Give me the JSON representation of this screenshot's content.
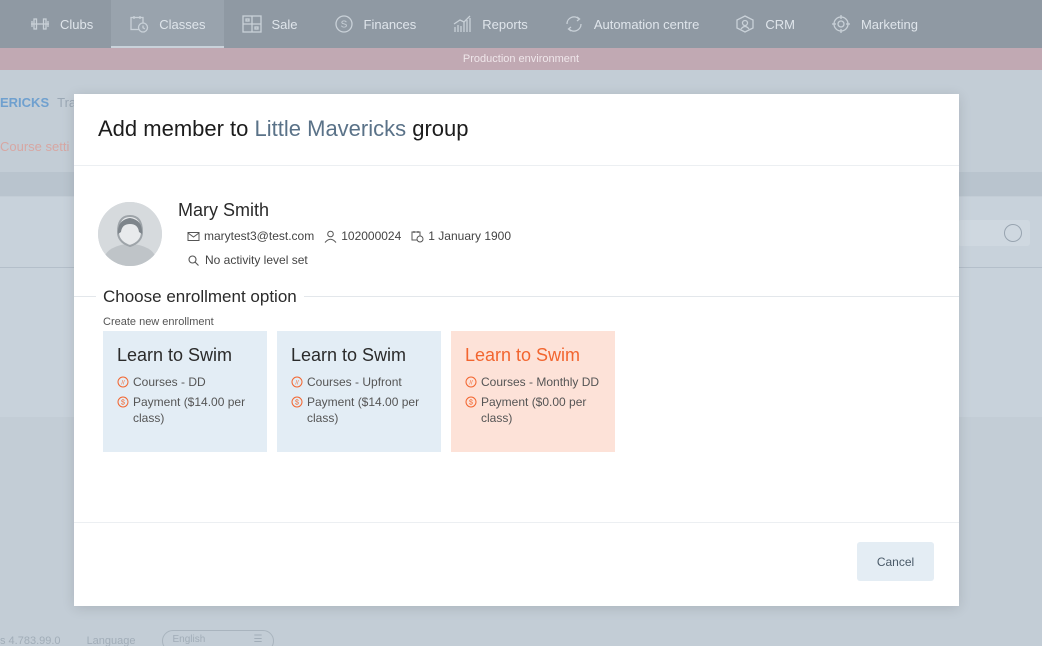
{
  "nav": {
    "items": [
      {
        "label": "Clubs",
        "icon": "dumbbell-icon"
      },
      {
        "label": "Classes",
        "icon": "calendar-clock-icon",
        "active": true
      },
      {
        "label": "Sale",
        "icon": "pos-icon"
      },
      {
        "label": "Finances",
        "icon": "dollar-coin-icon"
      },
      {
        "label": "Reports",
        "icon": "bar-chart-icon"
      },
      {
        "label": "Automation centre",
        "icon": "cycle-icon"
      },
      {
        "label": "CRM",
        "icon": "crm-icon"
      },
      {
        "label": "Marketing",
        "icon": "target-icon"
      }
    ]
  },
  "environment_banner": "Production environment",
  "background": {
    "breadcrumb_group": "ERICKS",
    "breadcrumb_tab": "Tra",
    "course_settings_link": "Course setti",
    "footer_version": "s 4.783.99.0",
    "footer_language_label": "Language",
    "footer_language_value": "English"
  },
  "modal": {
    "title_prefix": "Add member to",
    "group_name": "Little Mavericks",
    "title_suffix": "group",
    "member": {
      "name": "Mary Smith",
      "email": "marytest3@test.com",
      "member_id": "102000024",
      "birth_date": "1 January 1900",
      "activity_level": "No activity level set"
    },
    "section_title": "Choose enrollment option",
    "section_subtitle": "Create new enrollment",
    "options": [
      {
        "title": "Learn to Swim",
        "plan": "Courses - DD",
        "payment": "Payment ($14.00 per class)",
        "selected": false
      },
      {
        "title": "Learn to Swim",
        "plan": "Courses - Upfront",
        "payment": "Payment ($14.00 per class)",
        "selected": false
      },
      {
        "title": "Learn to Swim",
        "plan": "Courses - Monthly DD",
        "payment": "Payment ($0.00 per class)",
        "selected": true
      }
    ],
    "cancel_label": "Cancel"
  },
  "colors": {
    "accent_orange": "#f2652f",
    "selected_card_bg": "#fde2d8",
    "card_bg": "#e3edf5",
    "group_name": "#5a7288"
  }
}
